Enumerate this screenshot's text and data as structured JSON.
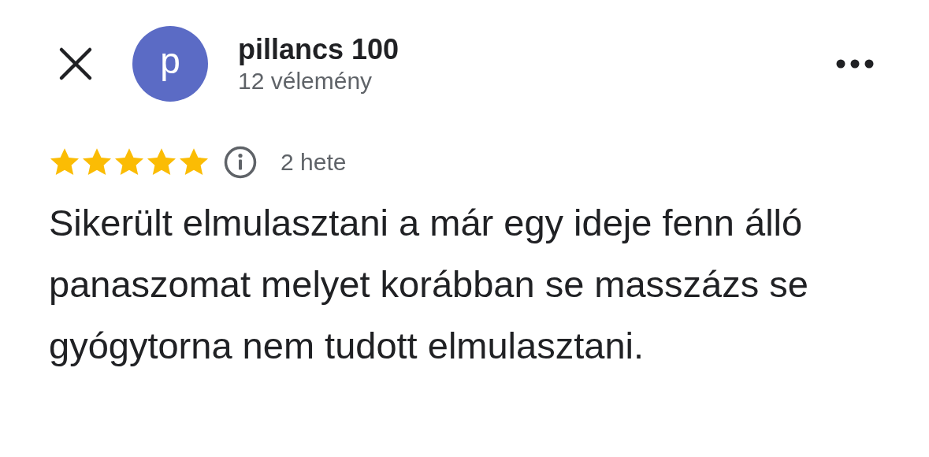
{
  "reviewer": {
    "initial": "p",
    "name": "pillancs 100",
    "review_count": "12 vélemény"
  },
  "review": {
    "stars": 5,
    "time": "2 hete",
    "text": "Sikerült elmulasztani a már egy ideje fenn álló panaszomat melyet korábban se masszázs se gyógytorna nem tudott elmulasztani."
  }
}
